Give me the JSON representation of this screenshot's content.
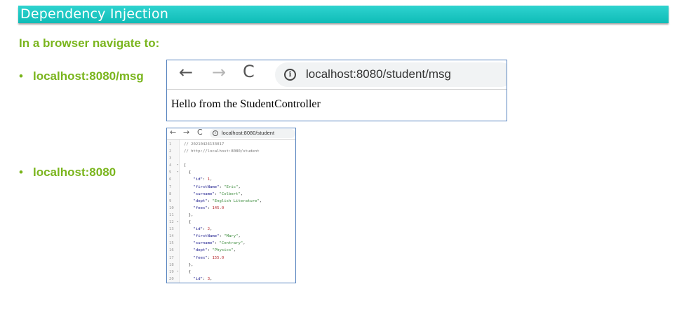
{
  "slide": {
    "title": "Dependency Injection",
    "subtitle": "In a browser navigate to:",
    "bullets": [
      {
        "dot": "•",
        "label": "localhost:8080/msg"
      },
      {
        "dot": "•",
        "label": "localhost:8080"
      }
    ]
  },
  "browser_msg": {
    "nav": {
      "back": "←",
      "forward": "→",
      "reload": "C"
    },
    "info_glyph": "i",
    "url": "localhost:8080/student/msg",
    "body": "Hello from the StudentController"
  },
  "browser_json": {
    "nav": {
      "back": "←",
      "forward": "→",
      "reload": "C"
    },
    "info_glyph": "i",
    "url": "localhost:8080/student",
    "lines": [
      {
        "n": "1",
        "fold": "",
        "parts": [
          {
            "t": "// 20210424133017",
            "c": "comment"
          }
        ]
      },
      {
        "n": "2",
        "fold": "",
        "parts": [
          {
            "t": "// http://localhost:8080/student",
            "c": "comment"
          }
        ]
      },
      {
        "n": "3",
        "fold": "",
        "parts": []
      },
      {
        "n": "4",
        "fold": "▾",
        "parts": [
          {
            "t": "[",
            "c": "punc"
          }
        ]
      },
      {
        "n": "5",
        "fold": "▾",
        "parts": [
          {
            "t": "  {",
            "c": "punc"
          }
        ]
      },
      {
        "n": "6",
        "fold": "",
        "parts": [
          {
            "t": "    \"id\"",
            "c": "key"
          },
          {
            "t": ": ",
            "c": "punc"
          },
          {
            "t": "1",
            "c": "num"
          },
          {
            "t": ",",
            "c": "punc"
          }
        ]
      },
      {
        "n": "7",
        "fold": "",
        "parts": [
          {
            "t": "    \"firstName\"",
            "c": "key"
          },
          {
            "t": ": ",
            "c": "punc"
          },
          {
            "t": "\"Eric\"",
            "c": "str"
          },
          {
            "t": ",",
            "c": "punc"
          }
        ]
      },
      {
        "n": "8",
        "fold": "",
        "parts": [
          {
            "t": "    \"surname\"",
            "c": "key"
          },
          {
            "t": ": ",
            "c": "punc"
          },
          {
            "t": "\"Colbert\"",
            "c": "str"
          },
          {
            "t": ",",
            "c": "punc"
          }
        ]
      },
      {
        "n": "9",
        "fold": "",
        "parts": [
          {
            "t": "    \"dept\"",
            "c": "key"
          },
          {
            "t": ": ",
            "c": "punc"
          },
          {
            "t": "\"English Literature\"",
            "c": "str"
          },
          {
            "t": ",",
            "c": "punc"
          }
        ]
      },
      {
        "n": "10",
        "fold": "",
        "parts": [
          {
            "t": "    \"fees\"",
            "c": "key"
          },
          {
            "t": ": ",
            "c": "punc"
          },
          {
            "t": "145.0",
            "c": "num"
          }
        ]
      },
      {
        "n": "11",
        "fold": "",
        "parts": [
          {
            "t": "  },",
            "c": "punc"
          }
        ]
      },
      {
        "n": "12",
        "fold": "▾",
        "parts": [
          {
            "t": "  {",
            "c": "punc"
          }
        ]
      },
      {
        "n": "13",
        "fold": "",
        "parts": [
          {
            "t": "    \"id\"",
            "c": "key"
          },
          {
            "t": ": ",
            "c": "punc"
          },
          {
            "t": "2",
            "c": "num"
          },
          {
            "t": ",",
            "c": "punc"
          }
        ]
      },
      {
        "n": "14",
        "fold": "",
        "parts": [
          {
            "t": "    \"firstName\"",
            "c": "key"
          },
          {
            "t": ": ",
            "c": "punc"
          },
          {
            "t": "\"Mary\"",
            "c": "str"
          },
          {
            "t": ",",
            "c": "punc"
          }
        ]
      },
      {
        "n": "15",
        "fold": "",
        "parts": [
          {
            "t": "    \"surname\"",
            "c": "key"
          },
          {
            "t": ": ",
            "c": "punc"
          },
          {
            "t": "\"Contrary\"",
            "c": "str"
          },
          {
            "t": ",",
            "c": "punc"
          }
        ]
      },
      {
        "n": "16",
        "fold": "",
        "parts": [
          {
            "t": "    \"dept\"",
            "c": "key"
          },
          {
            "t": ": ",
            "c": "punc"
          },
          {
            "t": "\"Physics\"",
            "c": "str"
          },
          {
            "t": ",",
            "c": "punc"
          }
        ]
      },
      {
        "n": "17",
        "fold": "",
        "parts": [
          {
            "t": "    \"fees\"",
            "c": "key"
          },
          {
            "t": ": ",
            "c": "punc"
          },
          {
            "t": "155.0",
            "c": "num"
          }
        ]
      },
      {
        "n": "18",
        "fold": "",
        "parts": [
          {
            "t": "  },",
            "c": "punc"
          }
        ]
      },
      {
        "n": "19",
        "fold": "▾",
        "parts": [
          {
            "t": "  {",
            "c": "punc"
          }
        ]
      },
      {
        "n": "20",
        "fold": "",
        "parts": [
          {
            "t": "    \"id\"",
            "c": "key"
          },
          {
            "t": ": ",
            "c": "punc"
          },
          {
            "t": "3",
            "c": "num"
          },
          {
            "t": ",",
            "c": "punc"
          }
        ]
      }
    ]
  },
  "colors": {
    "title_bar": "#0fbcb7",
    "heading_green": "#7ab51d",
    "frame_border": "#5a86c0"
  }
}
